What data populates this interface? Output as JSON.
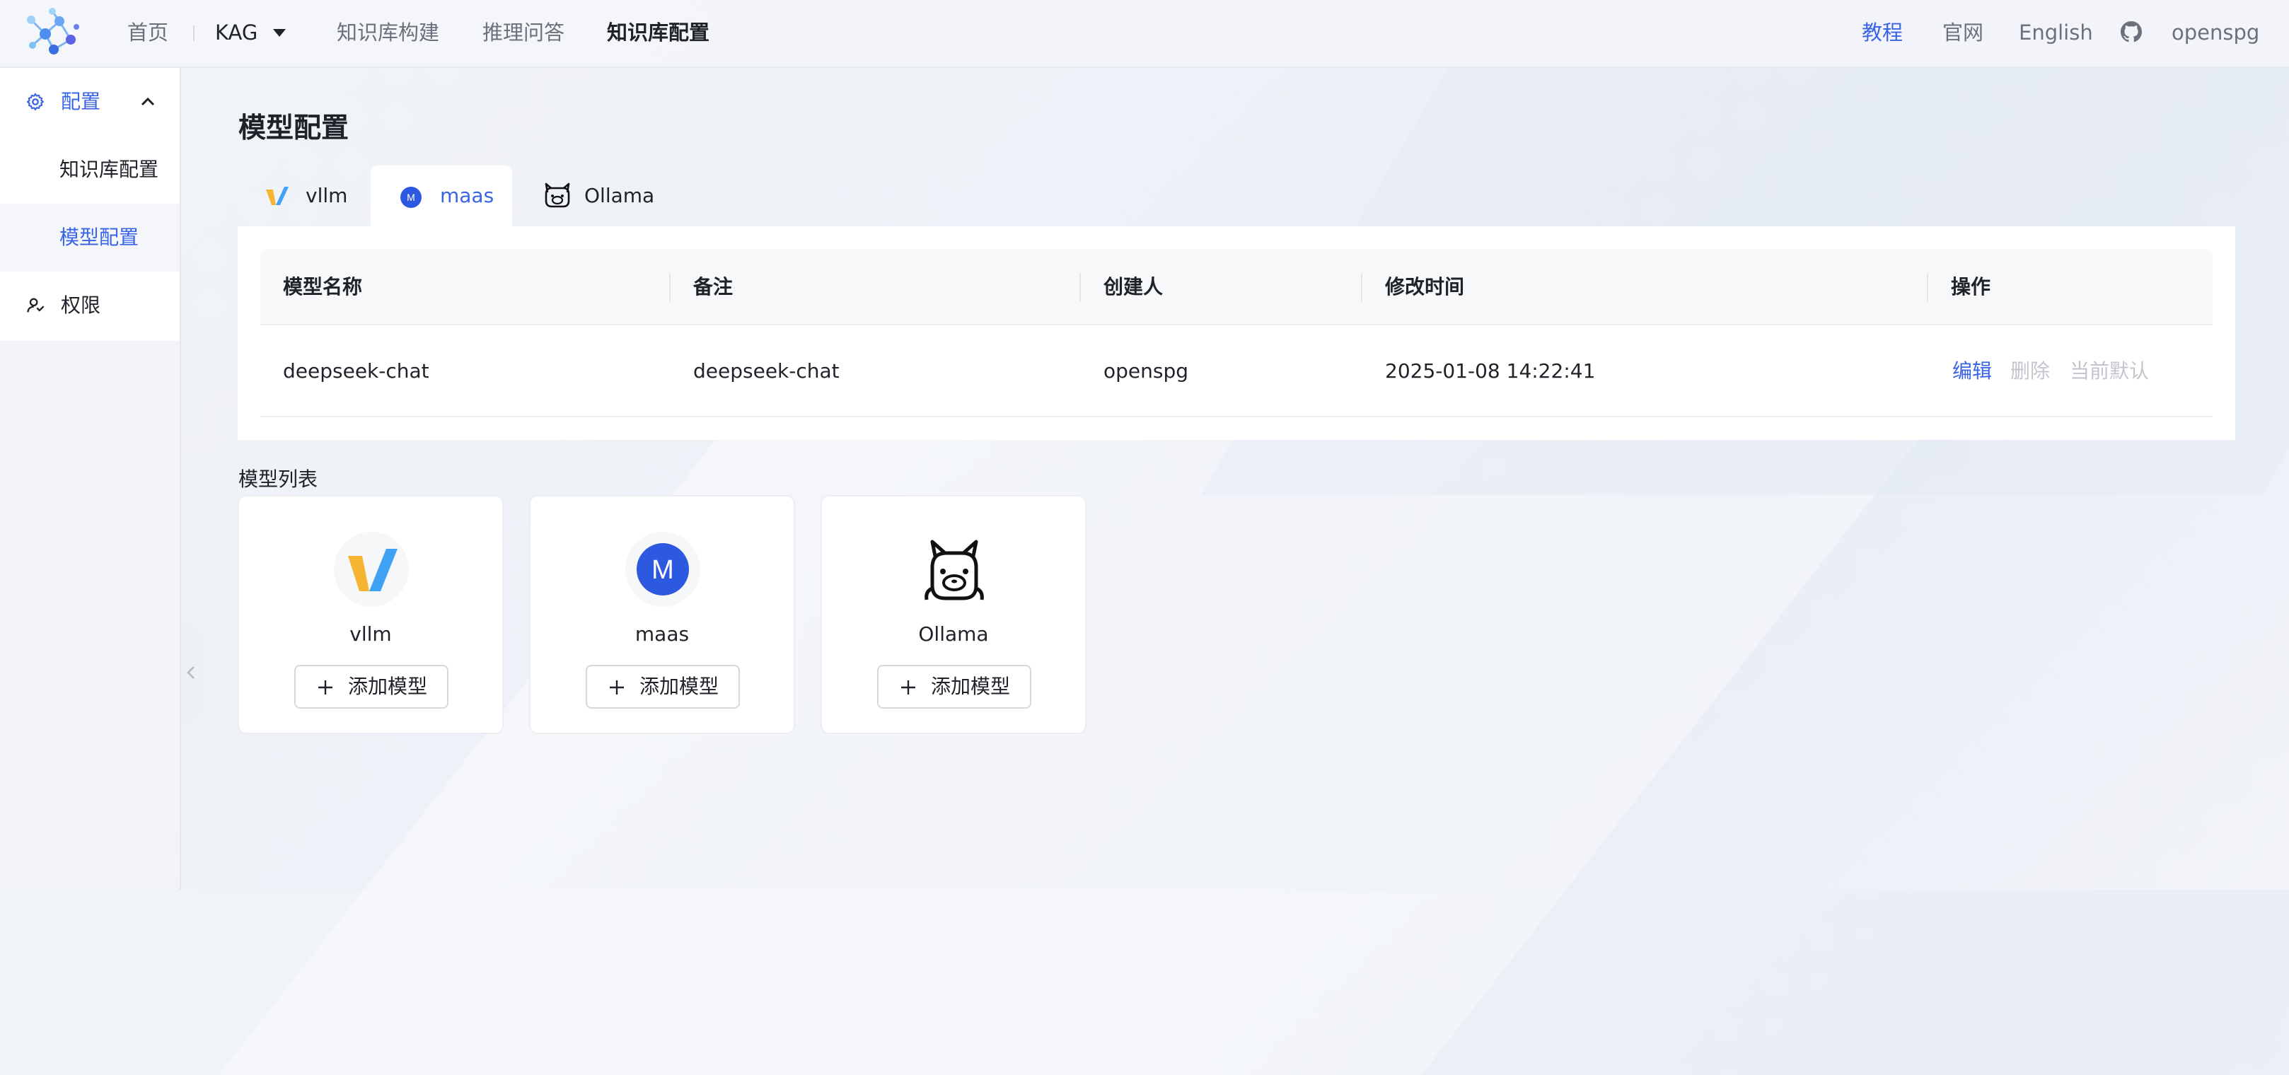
{
  "header": {
    "nav": {
      "home": "首页",
      "project": "KAG",
      "kb_build": "知识库构建",
      "reasoning_qa": "推理问答",
      "kb_config": "知识库配置"
    },
    "right": {
      "tutorial": "教程",
      "official_site": "官网",
      "language": "English",
      "user": "openspg"
    }
  },
  "sidebar": {
    "config_label": "配置",
    "items": [
      {
        "label": "知识库配置"
      },
      {
        "label": "模型配置"
      }
    ],
    "permissions_label": "权限"
  },
  "main": {
    "title": "模型配置",
    "tabs": [
      {
        "label": "vllm",
        "active": false
      },
      {
        "label": "maas",
        "active": true
      },
      {
        "label": "Ollama",
        "active": false
      }
    ],
    "table": {
      "headers": [
        "模型名称",
        "备注",
        "创建人",
        "修改时间",
        "操作"
      ],
      "rows": [
        {
          "name": "deepseek-chat",
          "remark": "deepseek-chat",
          "creator": "openspg",
          "modified": "2025-01-08 14:22:41",
          "actions": {
            "edit": "编辑",
            "delete": "删除",
            "set_default": "当前默认"
          }
        }
      ]
    },
    "list_title": "模型列表",
    "cards": [
      {
        "name": "vllm",
        "button": "添加模型",
        "icon": "vllm-logo"
      },
      {
        "name": "maas",
        "button": "添加模型",
        "icon": "maas-logo"
      },
      {
        "name": "Ollama",
        "button": "添加模型",
        "icon": "ollama-logo"
      }
    ],
    "maas_icon_letter": "M"
  },
  "colors": {
    "accent": "#3964e6",
    "text": "#1f2329",
    "muted": "#6a717c",
    "disabled": "#c2c5cb"
  }
}
